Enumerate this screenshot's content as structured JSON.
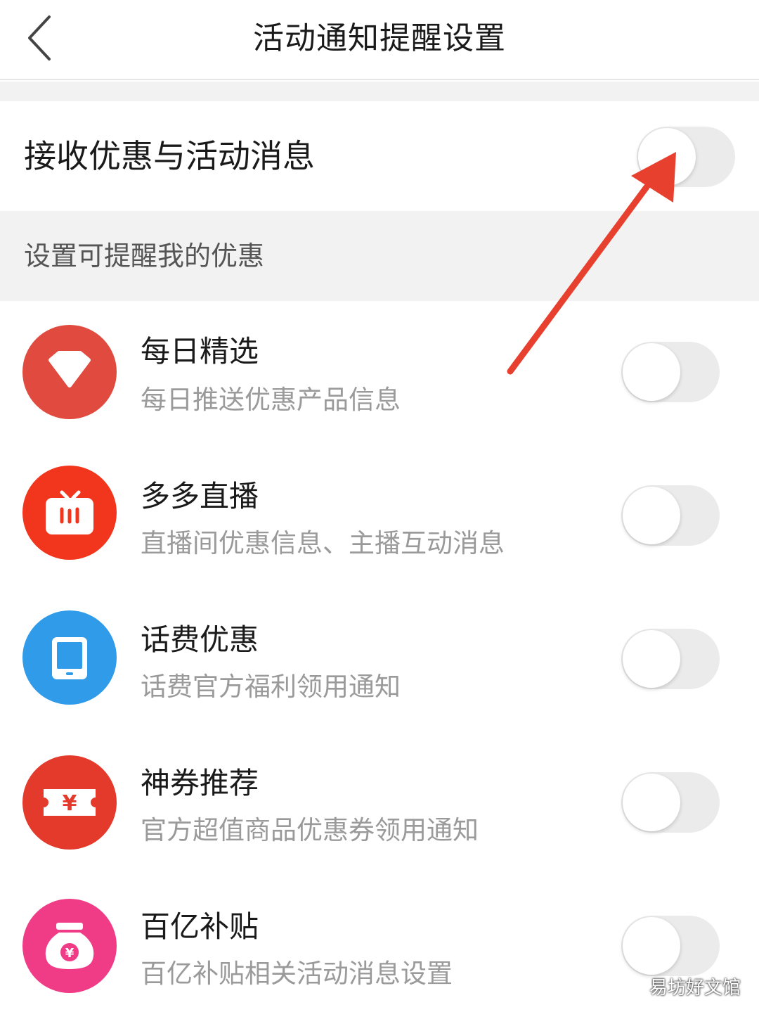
{
  "header": {
    "title": "活动通知提醒设置"
  },
  "master": {
    "label": "接收优惠与活动消息",
    "enabled": false
  },
  "section": {
    "label": "设置可提醒我的优惠"
  },
  "items": [
    {
      "title": "每日精选",
      "subtitle": "每日推送优惠产品信息",
      "icon": "diamond-icon",
      "color": "#e04a3f",
      "enabled": false
    },
    {
      "title": "多多直播",
      "subtitle": "直播间优惠信息、主播互动消息",
      "icon": "tv-icon",
      "color": "#f2361e",
      "enabled": false
    },
    {
      "title": "话费优惠",
      "subtitle": "话费官方福利领用通知",
      "icon": "phone-icon",
      "color": "#2f9be9",
      "enabled": false
    },
    {
      "title": "神券推荐",
      "subtitle": "官方超值商品优惠券领用通知",
      "icon": "coupon-icon",
      "color": "#e33a2c",
      "enabled": false,
      "glyph": "¥"
    },
    {
      "title": "百亿补贴",
      "subtitle": "百亿补贴相关活动消息设置",
      "icon": "money-bag-icon",
      "color": "#f03c87",
      "enabled": false,
      "glyph": "¥"
    }
  ],
  "colors": {
    "arrow": "#e8402f",
    "toggle_off": "#ebebeb",
    "section_bg": "#f2f2f2"
  },
  "watermark": "易坊好文馆"
}
